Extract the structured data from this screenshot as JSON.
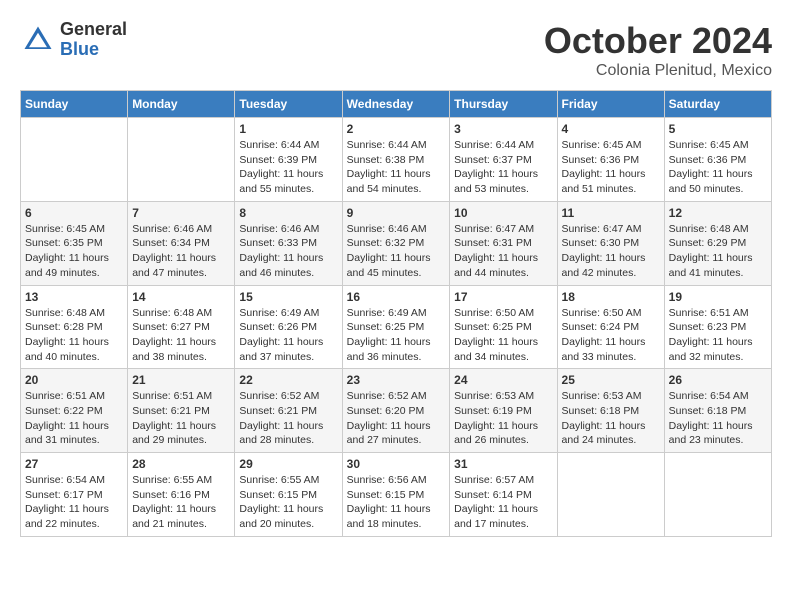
{
  "header": {
    "logo_general": "General",
    "logo_blue": "Blue",
    "month": "October 2024",
    "location": "Colonia Plenitud, Mexico"
  },
  "days_of_week": [
    "Sunday",
    "Monday",
    "Tuesday",
    "Wednesday",
    "Thursday",
    "Friday",
    "Saturday"
  ],
  "weeks": [
    [
      {
        "day": "",
        "info": ""
      },
      {
        "day": "",
        "info": ""
      },
      {
        "day": "1",
        "info": "Sunrise: 6:44 AM\nSunset: 6:39 PM\nDaylight: 11 hours and 55 minutes."
      },
      {
        "day": "2",
        "info": "Sunrise: 6:44 AM\nSunset: 6:38 PM\nDaylight: 11 hours and 54 minutes."
      },
      {
        "day": "3",
        "info": "Sunrise: 6:44 AM\nSunset: 6:37 PM\nDaylight: 11 hours and 53 minutes."
      },
      {
        "day": "4",
        "info": "Sunrise: 6:45 AM\nSunset: 6:36 PM\nDaylight: 11 hours and 51 minutes."
      },
      {
        "day": "5",
        "info": "Sunrise: 6:45 AM\nSunset: 6:36 PM\nDaylight: 11 hours and 50 minutes."
      }
    ],
    [
      {
        "day": "6",
        "info": "Sunrise: 6:45 AM\nSunset: 6:35 PM\nDaylight: 11 hours and 49 minutes."
      },
      {
        "day": "7",
        "info": "Sunrise: 6:46 AM\nSunset: 6:34 PM\nDaylight: 11 hours and 47 minutes."
      },
      {
        "day": "8",
        "info": "Sunrise: 6:46 AM\nSunset: 6:33 PM\nDaylight: 11 hours and 46 minutes."
      },
      {
        "day": "9",
        "info": "Sunrise: 6:46 AM\nSunset: 6:32 PM\nDaylight: 11 hours and 45 minutes."
      },
      {
        "day": "10",
        "info": "Sunrise: 6:47 AM\nSunset: 6:31 PM\nDaylight: 11 hours and 44 minutes."
      },
      {
        "day": "11",
        "info": "Sunrise: 6:47 AM\nSunset: 6:30 PM\nDaylight: 11 hours and 42 minutes."
      },
      {
        "day": "12",
        "info": "Sunrise: 6:48 AM\nSunset: 6:29 PM\nDaylight: 11 hours and 41 minutes."
      }
    ],
    [
      {
        "day": "13",
        "info": "Sunrise: 6:48 AM\nSunset: 6:28 PM\nDaylight: 11 hours and 40 minutes."
      },
      {
        "day": "14",
        "info": "Sunrise: 6:48 AM\nSunset: 6:27 PM\nDaylight: 11 hours and 38 minutes."
      },
      {
        "day": "15",
        "info": "Sunrise: 6:49 AM\nSunset: 6:26 PM\nDaylight: 11 hours and 37 minutes."
      },
      {
        "day": "16",
        "info": "Sunrise: 6:49 AM\nSunset: 6:25 PM\nDaylight: 11 hours and 36 minutes."
      },
      {
        "day": "17",
        "info": "Sunrise: 6:50 AM\nSunset: 6:25 PM\nDaylight: 11 hours and 34 minutes."
      },
      {
        "day": "18",
        "info": "Sunrise: 6:50 AM\nSunset: 6:24 PM\nDaylight: 11 hours and 33 minutes."
      },
      {
        "day": "19",
        "info": "Sunrise: 6:51 AM\nSunset: 6:23 PM\nDaylight: 11 hours and 32 minutes."
      }
    ],
    [
      {
        "day": "20",
        "info": "Sunrise: 6:51 AM\nSunset: 6:22 PM\nDaylight: 11 hours and 31 minutes."
      },
      {
        "day": "21",
        "info": "Sunrise: 6:51 AM\nSunset: 6:21 PM\nDaylight: 11 hours and 29 minutes."
      },
      {
        "day": "22",
        "info": "Sunrise: 6:52 AM\nSunset: 6:21 PM\nDaylight: 11 hours and 28 minutes."
      },
      {
        "day": "23",
        "info": "Sunrise: 6:52 AM\nSunset: 6:20 PM\nDaylight: 11 hours and 27 minutes."
      },
      {
        "day": "24",
        "info": "Sunrise: 6:53 AM\nSunset: 6:19 PM\nDaylight: 11 hours and 26 minutes."
      },
      {
        "day": "25",
        "info": "Sunrise: 6:53 AM\nSunset: 6:18 PM\nDaylight: 11 hours and 24 minutes."
      },
      {
        "day": "26",
        "info": "Sunrise: 6:54 AM\nSunset: 6:18 PM\nDaylight: 11 hours and 23 minutes."
      }
    ],
    [
      {
        "day": "27",
        "info": "Sunrise: 6:54 AM\nSunset: 6:17 PM\nDaylight: 11 hours and 22 minutes."
      },
      {
        "day": "28",
        "info": "Sunrise: 6:55 AM\nSunset: 6:16 PM\nDaylight: 11 hours and 21 minutes."
      },
      {
        "day": "29",
        "info": "Sunrise: 6:55 AM\nSunset: 6:15 PM\nDaylight: 11 hours and 20 minutes."
      },
      {
        "day": "30",
        "info": "Sunrise: 6:56 AM\nSunset: 6:15 PM\nDaylight: 11 hours and 18 minutes."
      },
      {
        "day": "31",
        "info": "Sunrise: 6:57 AM\nSunset: 6:14 PM\nDaylight: 11 hours and 17 minutes."
      },
      {
        "day": "",
        "info": ""
      },
      {
        "day": "",
        "info": ""
      }
    ]
  ]
}
